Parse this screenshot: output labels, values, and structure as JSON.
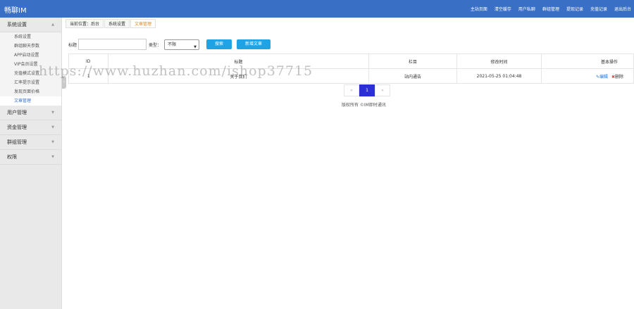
{
  "app": {
    "logo": "畅聊IM"
  },
  "topnav": [
    "主站页面",
    "清空缓存",
    "用户私聊",
    "群组管理",
    "提现记录",
    "充值记录",
    "退出后台"
  ],
  "sidebar": {
    "groups": [
      {
        "label": "系统设置",
        "expanded": true,
        "items": [
          "系统设置",
          "群组聊天参数",
          "APP启动设置",
          "VIP会员设置",
          "充值模式设置",
          "汇率提示设置",
          "发现页面价格",
          "文章管理"
        ],
        "active_item": "文章管理"
      },
      {
        "label": "用户管理",
        "expanded": false
      },
      {
        "label": "资金管理",
        "expanded": false
      },
      {
        "label": "群组管理",
        "expanded": false
      },
      {
        "label": "权限",
        "expanded": false
      }
    ]
  },
  "breadcrumb": [
    "当前位置：后台",
    "系统设置",
    "文章管理"
  ],
  "search": {
    "title_label": "标题",
    "title_value": "",
    "type_label": "类型：",
    "type_selected": "不限",
    "search_button": "搜索",
    "add_button": "新增文章"
  },
  "table": {
    "headers": [
      "ID",
      "标题",
      "栏目",
      "修改时间",
      "基本操作"
    ],
    "rows": [
      {
        "id": "1",
        "title": "关于我们",
        "column": "站内通告",
        "time": "2021-05-25 01:04:48",
        "edit": "编辑",
        "delete": "删除"
      }
    ]
  },
  "pagination": {
    "prev": "«",
    "current": "1",
    "next": "»"
  },
  "footer": {
    "copyright": "版权所有 ©IM即时通讯"
  },
  "watermark": "https://www.huzhan.com/ishop37715",
  "colors": {
    "topbar": "#3a6fc6",
    "accent_button": "#1ea3e6",
    "active_page": "#2c2fd6",
    "breadcrumb_current": "#e08a1e",
    "delete": "#e03c3c"
  }
}
